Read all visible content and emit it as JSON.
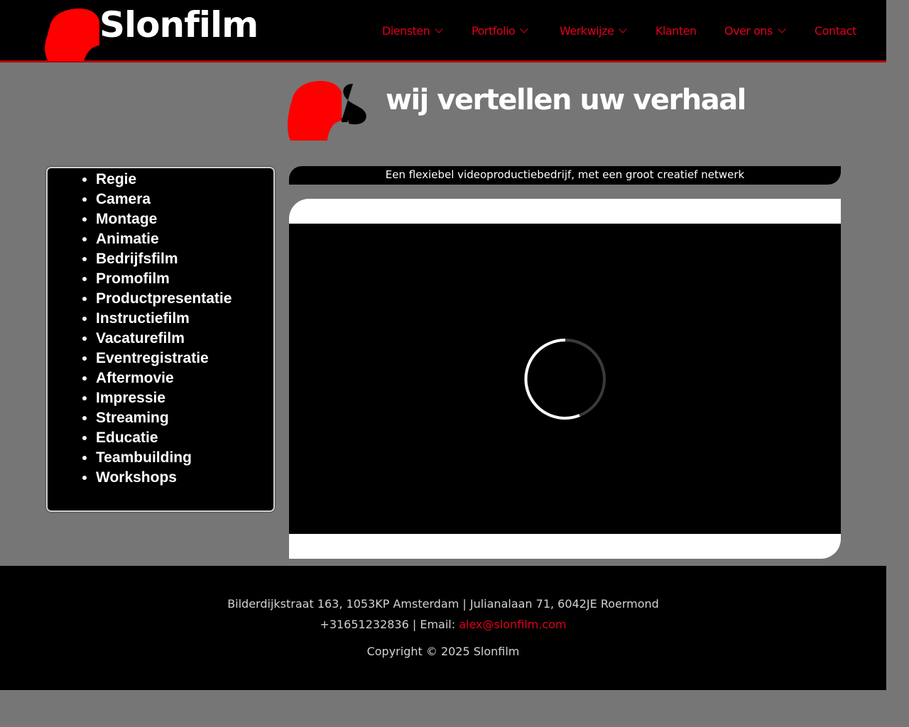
{
  "header": {
    "logo_text": "Slonfilm",
    "nav": [
      {
        "label": "Diensten",
        "has_dropdown": true
      },
      {
        "label": "Portfolio",
        "has_dropdown": true
      },
      {
        "label": "Werkwijze",
        "has_dropdown": true
      },
      {
        "label": "Klanten",
        "has_dropdown": false
      },
      {
        "label": "Over ons",
        "has_dropdown": true
      },
      {
        "label": "Contact",
        "has_dropdown": false
      }
    ]
  },
  "hero": {
    "tagline": "wij vertellen uw verhaal"
  },
  "sidebar": {
    "items": [
      "Regie",
      "Camera",
      "Montage",
      "Animatie",
      "Bedrijfsfilm",
      "Promofilm",
      "Productpresentatie",
      "Instructiefilm",
      "Vacaturefilm",
      "Eventregistratie",
      "Aftermovie",
      "Impressie",
      "Streaming",
      "Educatie",
      "Teambuilding",
      "Workshops"
    ]
  },
  "main": {
    "subtitle": "Een flexiebel videoproductiebedrijf, met een groot creatief netwerk",
    "video": {
      "state": "loading",
      "spinner_icon": "loading-spinner-icon"
    }
  },
  "footer": {
    "address": "Bilderdijkstraat 163, 1053KP Amsterdam  |  Julianalaan 71, 6042JE  Roermond",
    "phone": "+31651232836",
    "email_prefix": " | Email: ",
    "email": "alex@slonfilm.com",
    "copyright": "Copyright © 2025 Slonfilm"
  },
  "colors": {
    "brand_red": "#e3001b",
    "page_bg": "#767676",
    "header_bg": "#000000"
  }
}
